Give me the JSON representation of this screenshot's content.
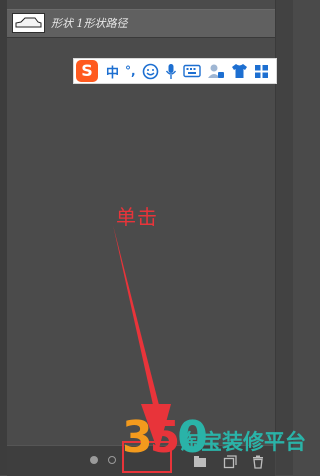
{
  "layer": {
    "name": "形状 1形状路径"
  },
  "ime_toolbar": {
    "logo_char": "S",
    "mode_label": "中",
    "punct_label": "°,",
    "icons": [
      "emoji-icon",
      "mic-icon",
      "keyboard-icon",
      "user-icon",
      "tshirt-icon",
      "grid-icon"
    ]
  },
  "annotation": {
    "text": "单击",
    "color": "#e8343a"
  },
  "watermark": {
    "number": "350",
    "text": "淘宝装修平台",
    "colors": {
      "three": "#f39a1d",
      "five": "#e8343a",
      "zero": "#2ab3a8",
      "text": "#2ab3a8"
    }
  },
  "colors": {
    "panel_bg": "#4b4b4b",
    "row_bg": "#606060",
    "ime_blue": "#1d6fd1",
    "ime_orange": "#ff5a1f"
  }
}
